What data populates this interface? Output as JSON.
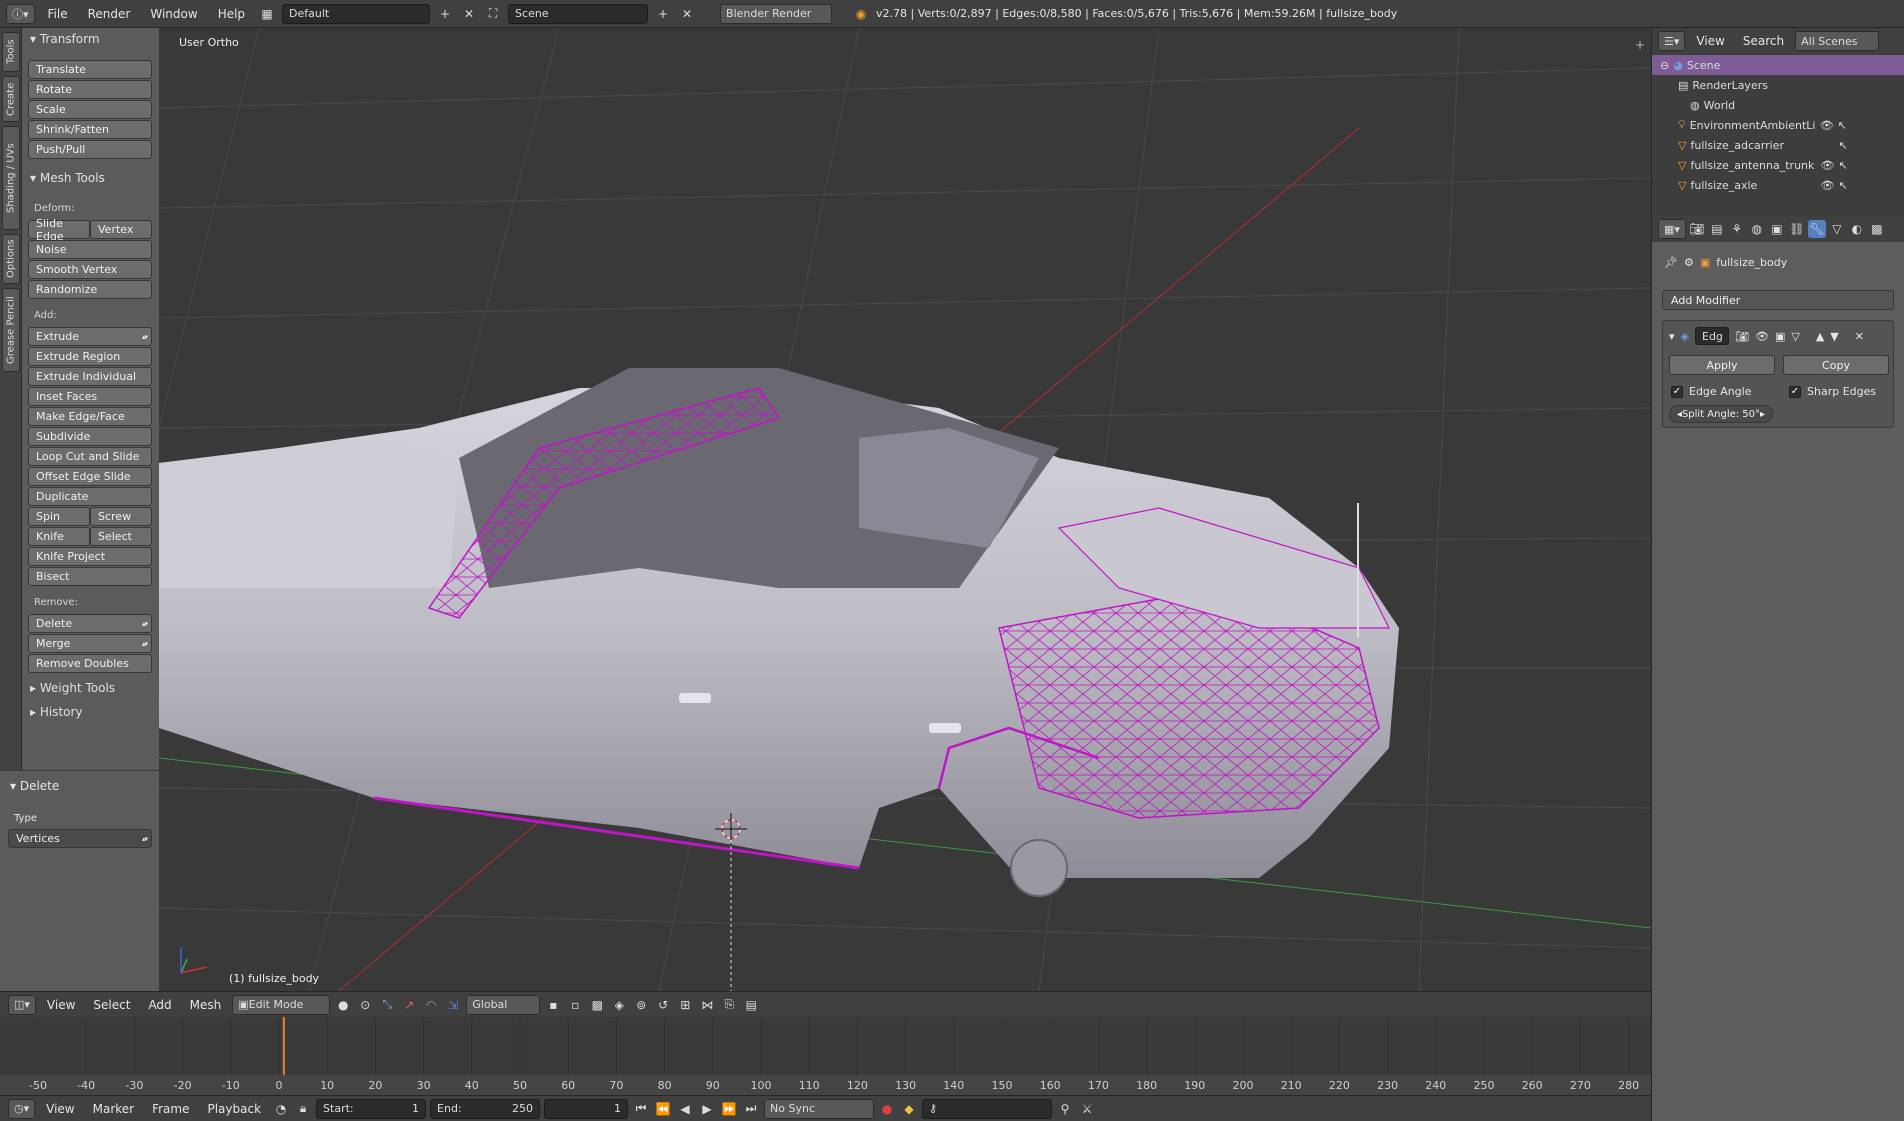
{
  "topbar": {
    "menus": [
      "File",
      "Render",
      "Window",
      "Help"
    ],
    "layout": "Default",
    "scene": "Scene",
    "engine": "Blender Render",
    "stats": "v2.78 | Verts:0/2,897 | Edges:0/8,580 | Faces:0/5,676 | Tris:5,676 | Mem:59.26M | fullsize_body"
  },
  "lefttabs": [
    "Tools",
    "Create",
    "Shading / UVs",
    "Options",
    "Grease Pencil"
  ],
  "toolshelf": {
    "transform_title": "Transform",
    "transform": [
      "Translate",
      "Rotate",
      "Scale",
      "Shrink/Fatten",
      "Push/Pull"
    ],
    "meshtools_title": "Mesh Tools",
    "deform_label": "Deform:",
    "slide_edge": "Slide Edge",
    "vertex": "Vertex",
    "deform": [
      "Noise",
      "Smooth Vertex",
      "Randomize"
    ],
    "add_label": "Add:",
    "extrude": "Extrude",
    "add": [
      "Extrude Region",
      "Extrude Individual",
      "Inset Faces",
      "Make Edge/Face",
      "Subdivide",
      "Loop Cut and Slide",
      "Offset Edge Slide",
      "Duplicate"
    ],
    "spin": "Spin",
    "screw": "Screw",
    "knife": "Knife",
    "select": "Select",
    "knife_project": "Knife Project",
    "bisect": "Bisect",
    "remove_label": "Remove:",
    "delete": "Delete",
    "merge": "Merge",
    "remove_doubles": "Remove Doubles",
    "weight_tools": "Weight Tools",
    "history": "History",
    "op_title": "Delete",
    "op_type_label": "Type",
    "op_type_value": "Vertices"
  },
  "viewport": {
    "view_name": "User Ortho",
    "object_name": "(1) fullsize_body"
  },
  "vpheader": {
    "menus": [
      "View",
      "Select",
      "Add",
      "Mesh"
    ],
    "mode": "Edit Mode",
    "orientation": "Global"
  },
  "timeline": {
    "ticks": [
      -50,
      -40,
      -30,
      -20,
      -10,
      0,
      10,
      20,
      30,
      40,
      50,
      60,
      70,
      80,
      90,
      100,
      110,
      120,
      130,
      140,
      150,
      160,
      170,
      180,
      190,
      200,
      210,
      220,
      230,
      240,
      250,
      260,
      270,
      280
    ],
    "current_frame": 1
  },
  "tlheader": {
    "menus": [
      "View",
      "Marker",
      "Frame",
      "Playback"
    ],
    "start_label": "Start:",
    "start": "1",
    "end_label": "End:",
    "end": "250",
    "current": "1",
    "sync": "No Sync"
  },
  "outliner": {
    "menus": [
      "View",
      "Search"
    ],
    "filter": "All Scenes",
    "items": [
      "Scene",
      "RenderLayers",
      "World",
      "EnvironmentAmbientLi",
      "fullsize_adcarrier",
      "fullsize_antenna_trunk",
      "fullsize_axle"
    ]
  },
  "properties": {
    "object": "fullsize_body",
    "add_modifier": "Add Modifier",
    "modifier_name": "Edg",
    "apply": "Apply",
    "copy": "Copy",
    "edge_angle": "Edge Angle",
    "sharp_edges": "Sharp Edges",
    "split_angle": "Split Angle: 50°"
  },
  "colors": {
    "wire": "#c014c8",
    "accent": "#5680c2",
    "frame_cursor": "#f08030"
  }
}
